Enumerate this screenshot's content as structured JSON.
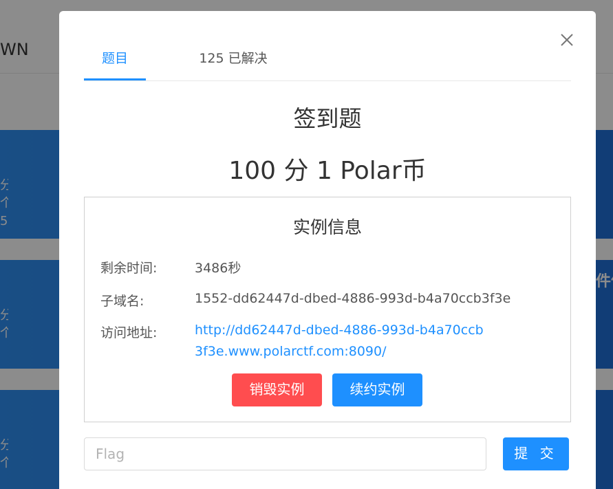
{
  "background": {
    "nav_text": "WN",
    "cards": [
      {
        "text": "分\n个\n5"
      },
      {
        "text": "分\n个"
      },
      {
        "text": "分\n个"
      }
    ],
    "side_text": "件信"
  },
  "modal": {
    "tabs": [
      {
        "label": "题目",
        "active": true
      },
      {
        "label": "125 已解决",
        "active": false
      }
    ],
    "challenge_title": "签到题",
    "points_line": "100 分 1 Polar币",
    "instance": {
      "heading": "实例信息",
      "remaining_label": "剩余时间:",
      "remaining_value": "3486秒",
      "subdomain_label": "子域名:",
      "subdomain_value": "1552-dd62447d-dbed-4886-993d-b4a70ccb3f3e",
      "address_label": "访问地址:",
      "address_value": "http://dd62447d-dbed-4886-993d-b4a70ccb3f3e.www.polarctf.com:8090/",
      "destroy_label": "销毁实例",
      "renew_label": "续约实例"
    },
    "flag": {
      "value": "",
      "placeholder": "Flag"
    },
    "submit_label": "提 交"
  },
  "colors": {
    "accent": "#1e90ff",
    "danger": "#ff4d4f",
    "overlay": "rgba(0,0,0,0.45)"
  },
  "icons": {
    "close": "close-icon"
  }
}
